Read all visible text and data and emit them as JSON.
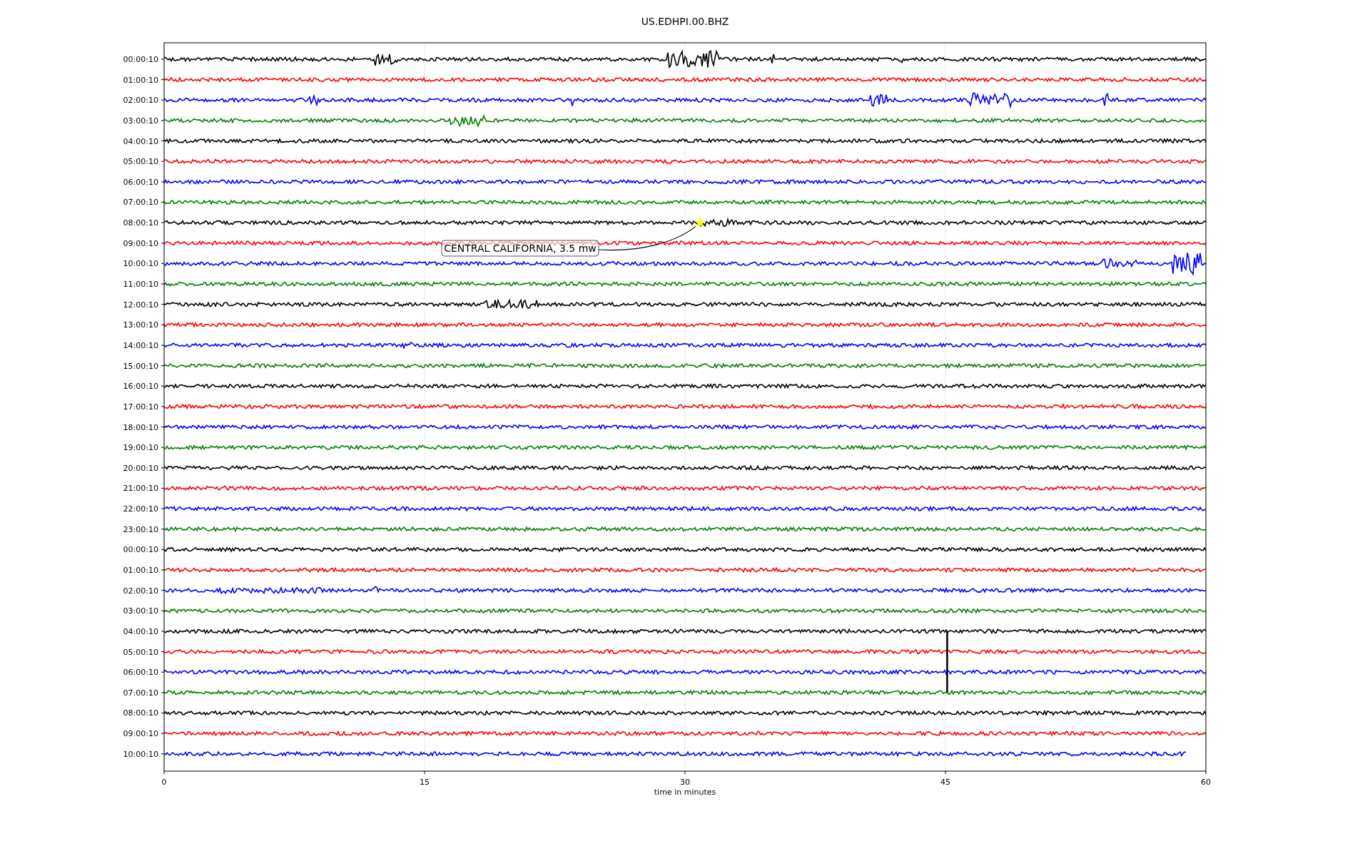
{
  "title": "US.EDHPI.00.BHZ",
  "rows": [
    {
      "label": "00:00:10",
      "color": "#000000"
    },
    {
      "label": "01:00:10",
      "color": "#ff0000"
    },
    {
      "label": "02:00:10",
      "color": "#0000ff"
    },
    {
      "label": "03:00:10",
      "color": "#008000"
    },
    {
      "label": "04:00:10",
      "color": "#000000"
    },
    {
      "label": "05:00:10",
      "color": "#ff0000"
    },
    {
      "label": "06:00:10",
      "color": "#0000ff"
    },
    {
      "label": "07:00:10",
      "color": "#008000"
    },
    {
      "label": "08:00:10",
      "color": "#000000"
    },
    {
      "label": "09:00:10",
      "color": "#ff0000"
    },
    {
      "label": "10:00:10",
      "color": "#0000ff"
    },
    {
      "label": "11:00:10",
      "color": "#008000"
    },
    {
      "label": "12:00:10",
      "color": "#000000"
    },
    {
      "label": "13:00:10",
      "color": "#ff0000"
    },
    {
      "label": "14:00:10",
      "color": "#0000ff"
    },
    {
      "label": "15:00:10",
      "color": "#008000"
    },
    {
      "label": "16:00:10",
      "color": "#000000"
    },
    {
      "label": "17:00:10",
      "color": "#ff0000"
    },
    {
      "label": "18:00:10",
      "color": "#0000ff"
    },
    {
      "label": "19:00:10",
      "color": "#008000"
    },
    {
      "label": "20:00:10",
      "color": "#000000"
    },
    {
      "label": "21:00:10",
      "color": "#ff0000"
    },
    {
      "label": "22:00:10",
      "color": "#0000ff"
    },
    {
      "label": "23:00:10",
      "color": "#008000"
    },
    {
      "label": "00:00:10",
      "color": "#000000"
    },
    {
      "label": "01:00:10",
      "color": "#ff0000"
    },
    {
      "label": "02:00:10",
      "color": "#0000ff"
    },
    {
      "label": "03:00:10",
      "color": "#008000"
    },
    {
      "label": "04:00:10",
      "color": "#000000"
    },
    {
      "label": "05:00:10",
      "color": "#ff0000"
    },
    {
      "label": "06:00:10",
      "color": "#0000ff"
    },
    {
      "label": "07:00:10",
      "color": "#008000"
    },
    {
      "label": "08:00:10",
      "color": "#000000"
    },
    {
      "label": "09:00:10",
      "color": "#ff0000"
    },
    {
      "label": "10:00:10",
      "color": "#0000ff"
    }
  ],
  "xticks": [
    "0",
    "15",
    "30",
    "45",
    "60"
  ],
  "xlabel": "time in minutes",
  "annotation": {
    "text": "CENTRAL CALIFORNIA, 3.5 mw"
  }
}
